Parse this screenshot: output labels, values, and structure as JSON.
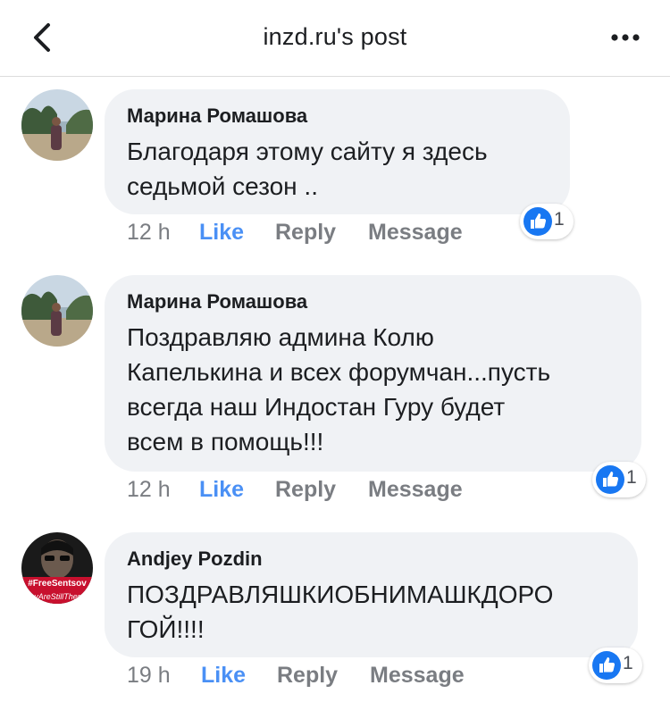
{
  "header": {
    "title": "inzd.ru's post",
    "back_icon": "chevron-left-icon",
    "more_icon": "more-horizontal-icon"
  },
  "comments": [
    {
      "author": "Марина Ромашова",
      "text_lines": [
        "Благодаря этому сайту я здесь",
        "седьмой сезон .."
      ],
      "time": "12 h",
      "like": "Like",
      "reply": "Reply",
      "message": "Message",
      "reactions": "1",
      "reaction_icon": "thumbs-up-icon"
    },
    {
      "author": "Марина Ромашова",
      "text_lines": [
        "Поздравляю админа Колю",
        "Капелькина и всех форумчан...пусть",
        "всегда наш Индостан Гуру будет",
        "всем в помощь!!!"
      ],
      "time": "12 h",
      "like": "Like",
      "reply": "Reply",
      "message": "Message",
      "reactions": "1",
      "reaction_icon": "thumbs-up-icon"
    },
    {
      "author": "Andjey Pozdin",
      "text_lines": [
        "ПОЗДРАВЛЯШКИОБНИМАШКДОРО",
        "ГОЙ!!!!"
      ],
      "time": "19 h",
      "like": "Like",
      "reply": "Reply",
      "message": "Message",
      "reactions": "1",
      "reaction_icon": "thumbs-up-icon",
      "avatar_text": [
        "#FreeSentsov",
        "eyAreStillThere"
      ]
    }
  ],
  "colors": {
    "link_blue": "#4a90f5",
    "facebook_blue": "#1877f2",
    "bubble_bg": "#f0f2f5",
    "meta_gray": "#7a7d82"
  }
}
